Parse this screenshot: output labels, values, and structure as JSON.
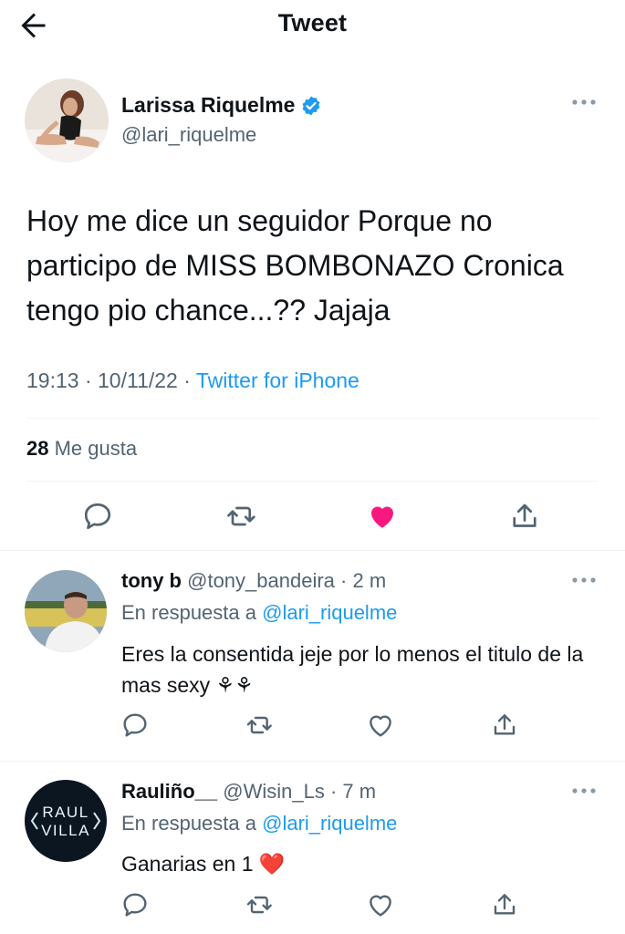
{
  "header": {
    "title": "Tweet",
    "back_icon": "arrow-left-icon"
  },
  "tweet": {
    "author_name": "Larissa Riquelme",
    "author_handle": "@lari_riquelme",
    "verified": true,
    "text": "Hoy me dice un seguidor Porque no participo de MISS BOMBONAZO Cronica tengo pio chance...?? Jajaja",
    "time": "19:13",
    "date": "10/11/22",
    "source": "Twitter for iPhone",
    "likes_count": "28",
    "likes_label": "Me gusta",
    "liked": true,
    "like_color": "#f91880"
  },
  "replies": [
    {
      "name": "tony b",
      "handle": "@tony_bandeira",
      "time": "2 m",
      "reply_prefix": "En respuesta a",
      "reply_to": "@lari_riquelme",
      "text": "Eres la consentida jeje por lo menos el titulo de la mas sexy ⚘⚘"
    },
    {
      "name": "Rauliño__",
      "handle": "@Wisin_Ls",
      "time": "7 m",
      "reply_prefix": "En respuesta a",
      "reply_to": "@lari_riquelme",
      "text": "Ganarias en 1",
      "emoji": "❤️",
      "avatar_text_1": "RAUL",
      "avatar_text_2": "VILLA"
    }
  ],
  "colors": {
    "accent": "#1d9bf0",
    "secondary_text": "#536471",
    "divider": "#eff3f4"
  }
}
